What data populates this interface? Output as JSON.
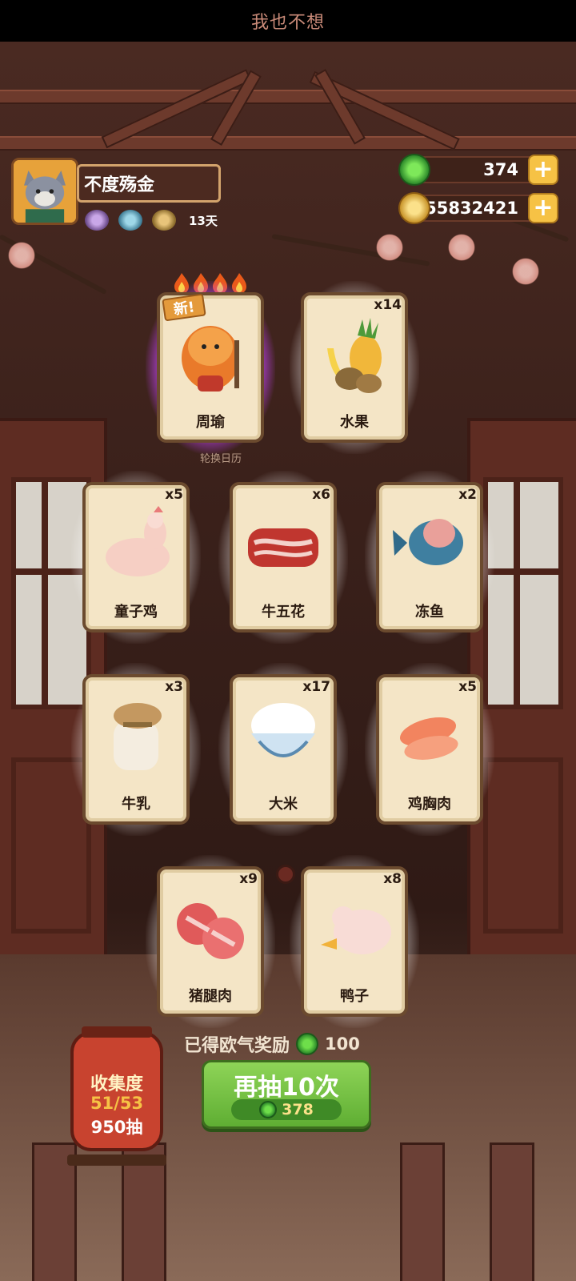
{
  "topbar": {
    "title": "我也不想"
  },
  "player": {
    "name": "不度殇金",
    "buff_days": "13天"
  },
  "currency": {
    "jade": {
      "value": "374",
      "icon": "jade-coin-icon",
      "add_label": "+"
    },
    "gold": {
      "value": "55832421",
      "icon": "gold-coin-icon",
      "add_label": "+"
    }
  },
  "rotation_label": "轮换日历",
  "new_tag": "新!",
  "cards": [
    {
      "name": "周瑜",
      "count": "",
      "rarity": "legendary",
      "icon": "zhou-yu-character-icon"
    },
    {
      "name": "水果",
      "count": "x14",
      "icon": "fruit-icon"
    },
    {
      "name": "童子鸡",
      "count": "x5",
      "icon": "chicken-icon"
    },
    {
      "name": "牛五花",
      "count": "x6",
      "icon": "beef-belly-icon"
    },
    {
      "name": "冻鱼",
      "count": "x2",
      "icon": "frozen-fish-icon"
    },
    {
      "name": "牛乳",
      "count": "x3",
      "icon": "milk-jar-icon"
    },
    {
      "name": "大米",
      "count": "x17",
      "icon": "rice-bowl-icon"
    },
    {
      "name": "鸡胸肉",
      "count": "x5",
      "icon": "chicken-breast-icon"
    },
    {
      "name": "猪腿肉",
      "count": "x9",
      "icon": "pork-leg-icon"
    },
    {
      "name": "鸭子",
      "count": "x8",
      "icon": "duck-icon"
    }
  ],
  "reward": {
    "label": "已得欧气奖励",
    "value": "100"
  },
  "draw_button": {
    "label": "再抽10次",
    "cost": "378"
  },
  "collection": {
    "label": "收集度",
    "progress": "51/53",
    "draws": "950抽"
  },
  "colors": {
    "accent_green": "#5fae33",
    "gold": "#f6c245",
    "card_bg": "#f4e5c6",
    "legendary_glow": "#c846ff"
  }
}
